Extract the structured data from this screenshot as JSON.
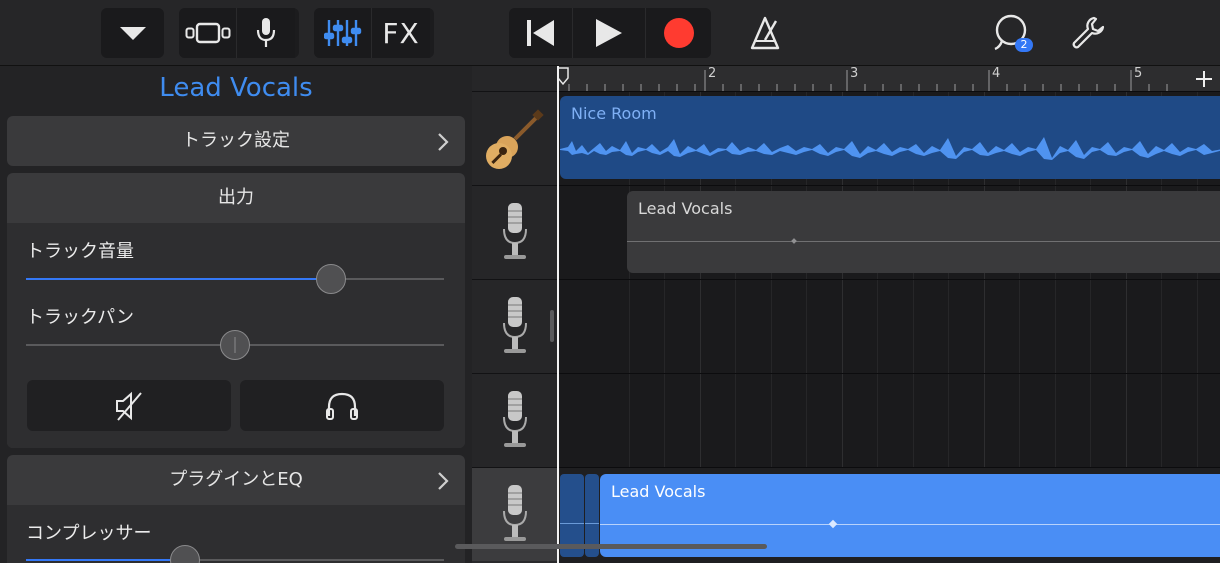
{
  "toolbar": {
    "fx_label": "FX",
    "loop_badge": "2"
  },
  "inspector": {
    "title": "Lead Vocals",
    "track_settings": "トラック設定",
    "output_header": "出力",
    "track_volume_label": "トラック音量",
    "track_volume": 0.73,
    "track_pan_label": "トラックパン",
    "track_pan": 0.5,
    "plugins_eq": "プラグインとEQ",
    "compressor_label": "コンプレッサー",
    "compressor": 0.38
  },
  "ruler": {
    "bars": [
      "2",
      "3",
      "4",
      "5"
    ]
  },
  "regions": {
    "nice_room": "Nice Room",
    "lead_vocals_1": "Lead Vocals",
    "lead_vocals_2": "Lead Vocals"
  },
  "colors": {
    "accent": "#3478f6",
    "record": "#ff3b30",
    "audio_region_dark": "#1f4a86",
    "audio_region_bright": "#4a8ef5"
  },
  "icons": {
    "view": "chevron-down-icon",
    "track_view": "track-view-icon",
    "mic": "microphone-icon",
    "mixer": "mixer-icon",
    "rewind": "go-to-start-icon",
    "play": "play-icon",
    "record": "record-icon",
    "metronome": "metronome-icon",
    "loops": "loop-browser-icon",
    "settings": "wrench-icon"
  }
}
